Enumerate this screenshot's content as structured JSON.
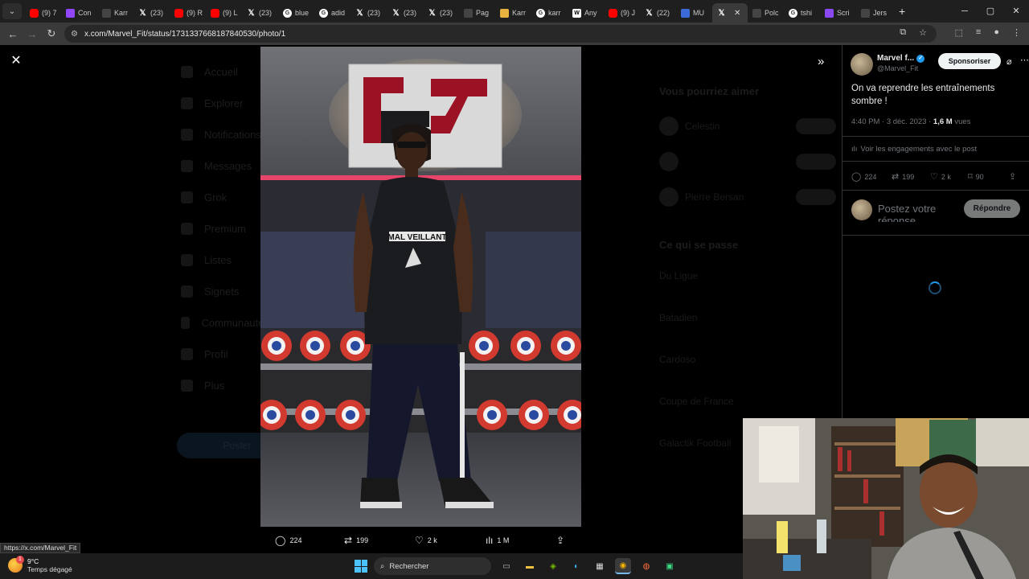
{
  "browser": {
    "tabs": [
      {
        "label": "(9) 7",
        "icon": "youtube-icon"
      },
      {
        "label": "Con",
        "icon": "twitch-icon"
      },
      {
        "label": "Karr",
        "icon": "page-icon"
      },
      {
        "label": "(23)",
        "icon": "x-icon"
      },
      {
        "label": "(9) R",
        "icon": "youtube-icon"
      },
      {
        "label": "(9) L",
        "icon": "youtube-icon"
      },
      {
        "label": "(23)",
        "icon": "x-icon"
      },
      {
        "label": "blue",
        "icon": "google-icon"
      },
      {
        "label": "adid",
        "icon": "google-icon"
      },
      {
        "label": "(23)",
        "icon": "x-icon"
      },
      {
        "label": "(23)",
        "icon": "x-icon"
      },
      {
        "label": "(23)",
        "icon": "x-icon"
      },
      {
        "label": "Pag",
        "icon": "page-icon"
      },
      {
        "label": "Karr",
        "icon": "folder-icon"
      },
      {
        "label": "karr",
        "icon": "google-icon"
      },
      {
        "label": "Any",
        "icon": "wikipedia-icon"
      },
      {
        "label": "(9) J",
        "icon": "youtube-icon"
      },
      {
        "label": "(22)",
        "icon": "x-icon"
      },
      {
        "label": "MU",
        "icon": "mu-icon"
      },
      {
        "label": "",
        "icon": "x-icon",
        "active": true
      },
      {
        "label": "Polc",
        "icon": "page-icon"
      },
      {
        "label": "tshi",
        "icon": "google-icon"
      },
      {
        "label": "Scri",
        "icon": "script-icon"
      },
      {
        "label": "Jers",
        "icon": "page-icon"
      }
    ],
    "url": "x.com/Marvel_Fit/status/1731337668187840530/photo/1",
    "status_link": "https://x.com/Marvel_Fit"
  },
  "background_nav": {
    "items": [
      "Accueil",
      "Explorer",
      "Notifications",
      "Messages",
      "Grok",
      "Premium",
      "Listes",
      "Signets",
      "Communautés",
      "Profil",
      "Plus"
    ],
    "post_button": "Poster"
  },
  "background_right": {
    "suggest_title": "Vous pourriez aimer",
    "suggestions": [
      "Celestin",
      "",
      "Pierre Bersan"
    ],
    "trends_title": "Ce qui se passe",
    "trends": [
      "Du Ligue",
      "Batadien",
      "Cardoso",
      "Coupe de France",
      "Galactik Football"
    ]
  },
  "photo_stats": {
    "replies": "224",
    "reposts": "199",
    "likes": "2 k",
    "views": "1 M"
  },
  "tweet": {
    "display_name": "Marvel f...",
    "handle": "@Marvel_Fit",
    "sponsor_button": "Sponsoriser",
    "text": "On va reprendre les entraînements sombre !",
    "time": "4:40 PM · 3 déc. 2023 ·",
    "views_count": "1,6 M",
    "views_label": "vues",
    "engagements": "Voir les engagements avec le post",
    "replies": "224",
    "reposts": "199",
    "likes": "2 k",
    "bookmarks": "90",
    "reply_placeholder": "Postez votre réponse",
    "reply_button": "Répondre"
  },
  "photo_text": {
    "shirt": "MAL VEILLANT"
  },
  "taskbar": {
    "temperature": "9°C",
    "weather": "Temps dégagé",
    "search": "Rechercher"
  },
  "colors": {
    "x_blue": "#1d9bf0",
    "background": "#000000",
    "muted_text": "#71767b"
  }
}
